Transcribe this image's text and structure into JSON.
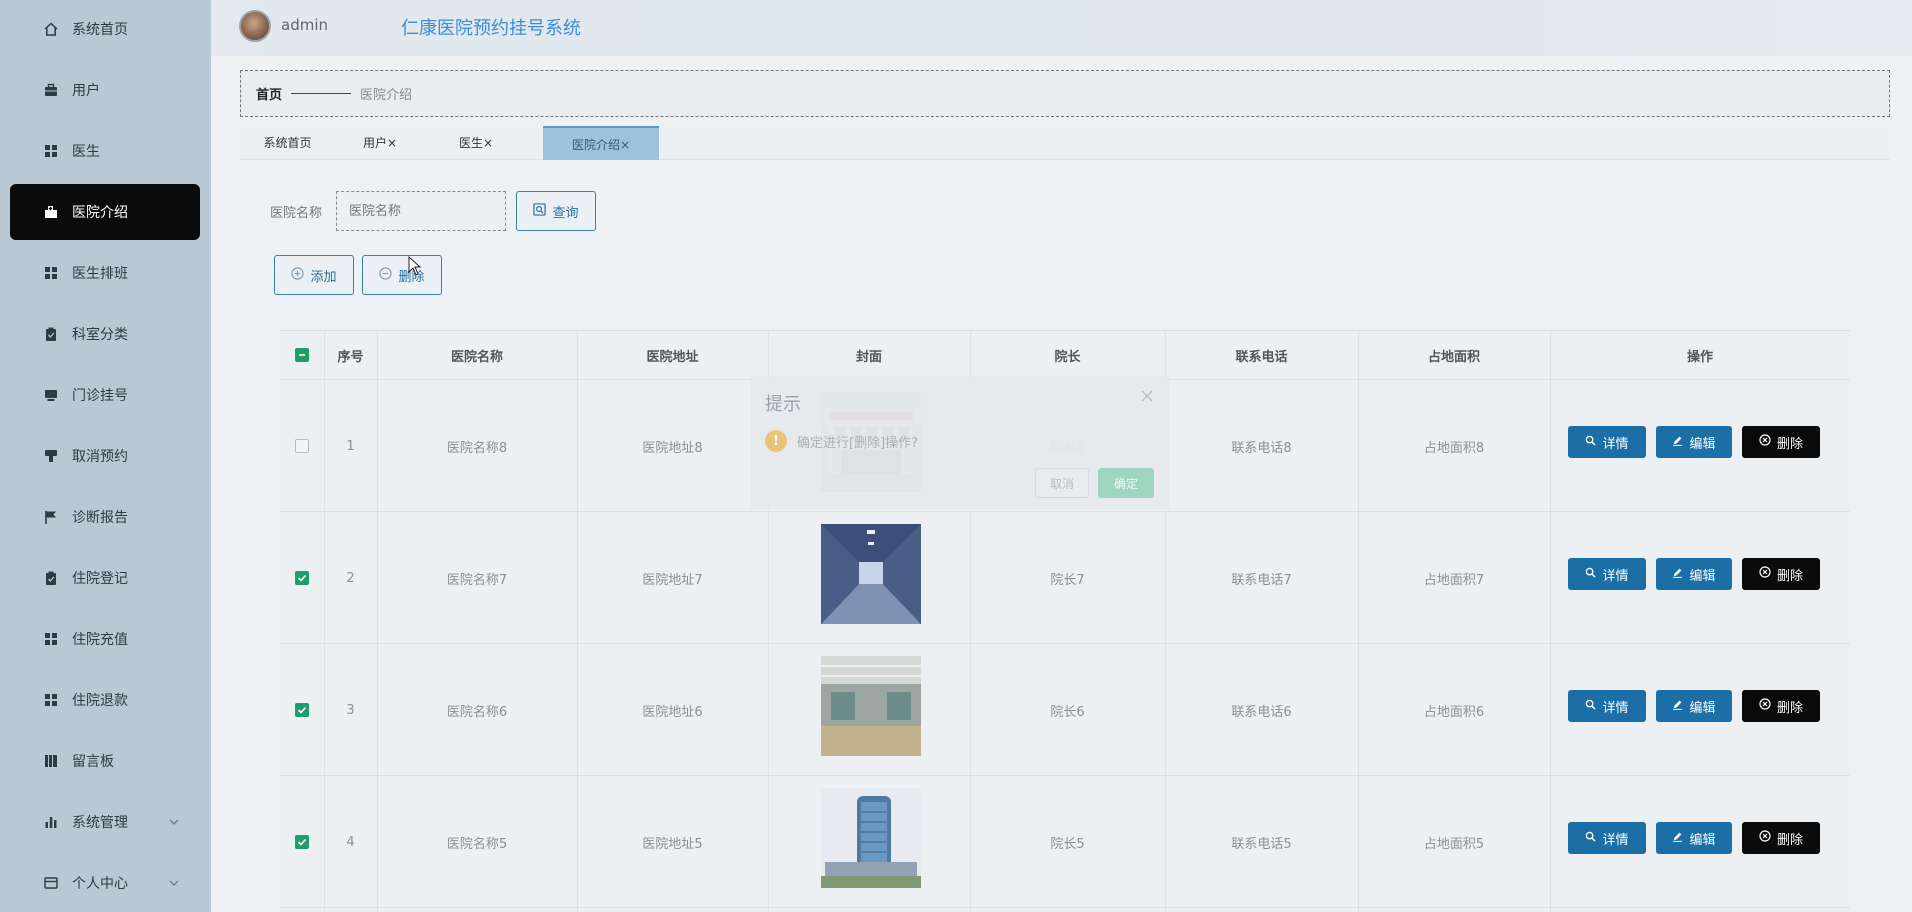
{
  "sidebar": {
    "items": [
      {
        "label": "系统首页",
        "icon": "home-icon"
      },
      {
        "label": "用户",
        "icon": "briefcase-icon"
      },
      {
        "label": "医生",
        "icon": "grid-icon"
      },
      {
        "label": "医院介绍",
        "icon": "hospital-icon",
        "active": true
      },
      {
        "label": "医生排班",
        "icon": "grid-icon"
      },
      {
        "label": "科室分类",
        "icon": "clipboard-icon"
      },
      {
        "label": "门诊挂号",
        "icon": "printer-icon"
      },
      {
        "label": "取消预约",
        "icon": "stamp-icon"
      },
      {
        "label": "诊断报告",
        "icon": "flag-icon"
      },
      {
        "label": "住院登记",
        "icon": "clipboard-icon"
      },
      {
        "label": "住院充值",
        "icon": "grid-icon"
      },
      {
        "label": "住院退款",
        "icon": "grid-icon"
      },
      {
        "label": "留言板",
        "icon": "book-icon"
      },
      {
        "label": "系统管理",
        "icon": "bar-chart-icon",
        "expandable": true
      },
      {
        "label": "个人中心",
        "icon": "card-icon",
        "expandable": true
      }
    ]
  },
  "header": {
    "username": "admin",
    "title": "仁康医院预约挂号系统"
  },
  "breadcrumb": {
    "home": "首页",
    "current": "医院介绍"
  },
  "tabs": [
    {
      "label": "系统首页",
      "closable": false
    },
    {
      "label": "用户",
      "closable": true
    },
    {
      "label": "医生",
      "closable": true
    },
    {
      "label": "医院介绍",
      "closable": true,
      "active": true
    }
  ],
  "tab_close_glyph": "×",
  "search": {
    "label": "医院名称",
    "placeholder": "医院名称",
    "button": "查询"
  },
  "actions": {
    "add": "添加",
    "delete": "删除"
  },
  "table": {
    "columns": [
      "序号",
      "医院名称",
      "医院地址",
      "封面",
      "院长",
      "联系电话",
      "占地面积",
      "操作"
    ],
    "rows": [
      {
        "index": "1",
        "name": "医院名称8",
        "address": "医院地址8",
        "cover": "hospital-exterior",
        "director": "院长8",
        "phone": "联系电话8",
        "area": "占地面积8",
        "checked": false
      },
      {
        "index": "2",
        "name": "医院名称7",
        "address": "医院地址7",
        "cover": "hospital-corridor",
        "director": "院长7",
        "phone": "联系电话7",
        "area": "占地面积7",
        "checked": true
      },
      {
        "index": "3",
        "name": "医院名称6",
        "address": "医院地址6",
        "cover": "hospital-lobby",
        "director": "院长6",
        "phone": "联系电话6",
        "area": "占地面积6",
        "checked": true
      },
      {
        "index": "4",
        "name": "医院名称5",
        "address": "医院地址5",
        "cover": "hospital-tower",
        "director": "院长5",
        "phone": "联系电话5",
        "area": "占地面积5",
        "checked": true
      }
    ],
    "row_actions": {
      "detail": "详情",
      "edit": "编辑",
      "delete": "删除"
    }
  },
  "modal": {
    "title": "提示",
    "message": "确定进行[删除]操作?",
    "cancel": "取消",
    "confirm": "确定"
  },
  "colors": {
    "sidebar_bg": "#b9c9d3",
    "active_nav": "#0b0b0b",
    "title_blue": "#3b8ed6",
    "action_blue": "#1b6ea6",
    "checkbox_green": "#1f9e6a"
  }
}
